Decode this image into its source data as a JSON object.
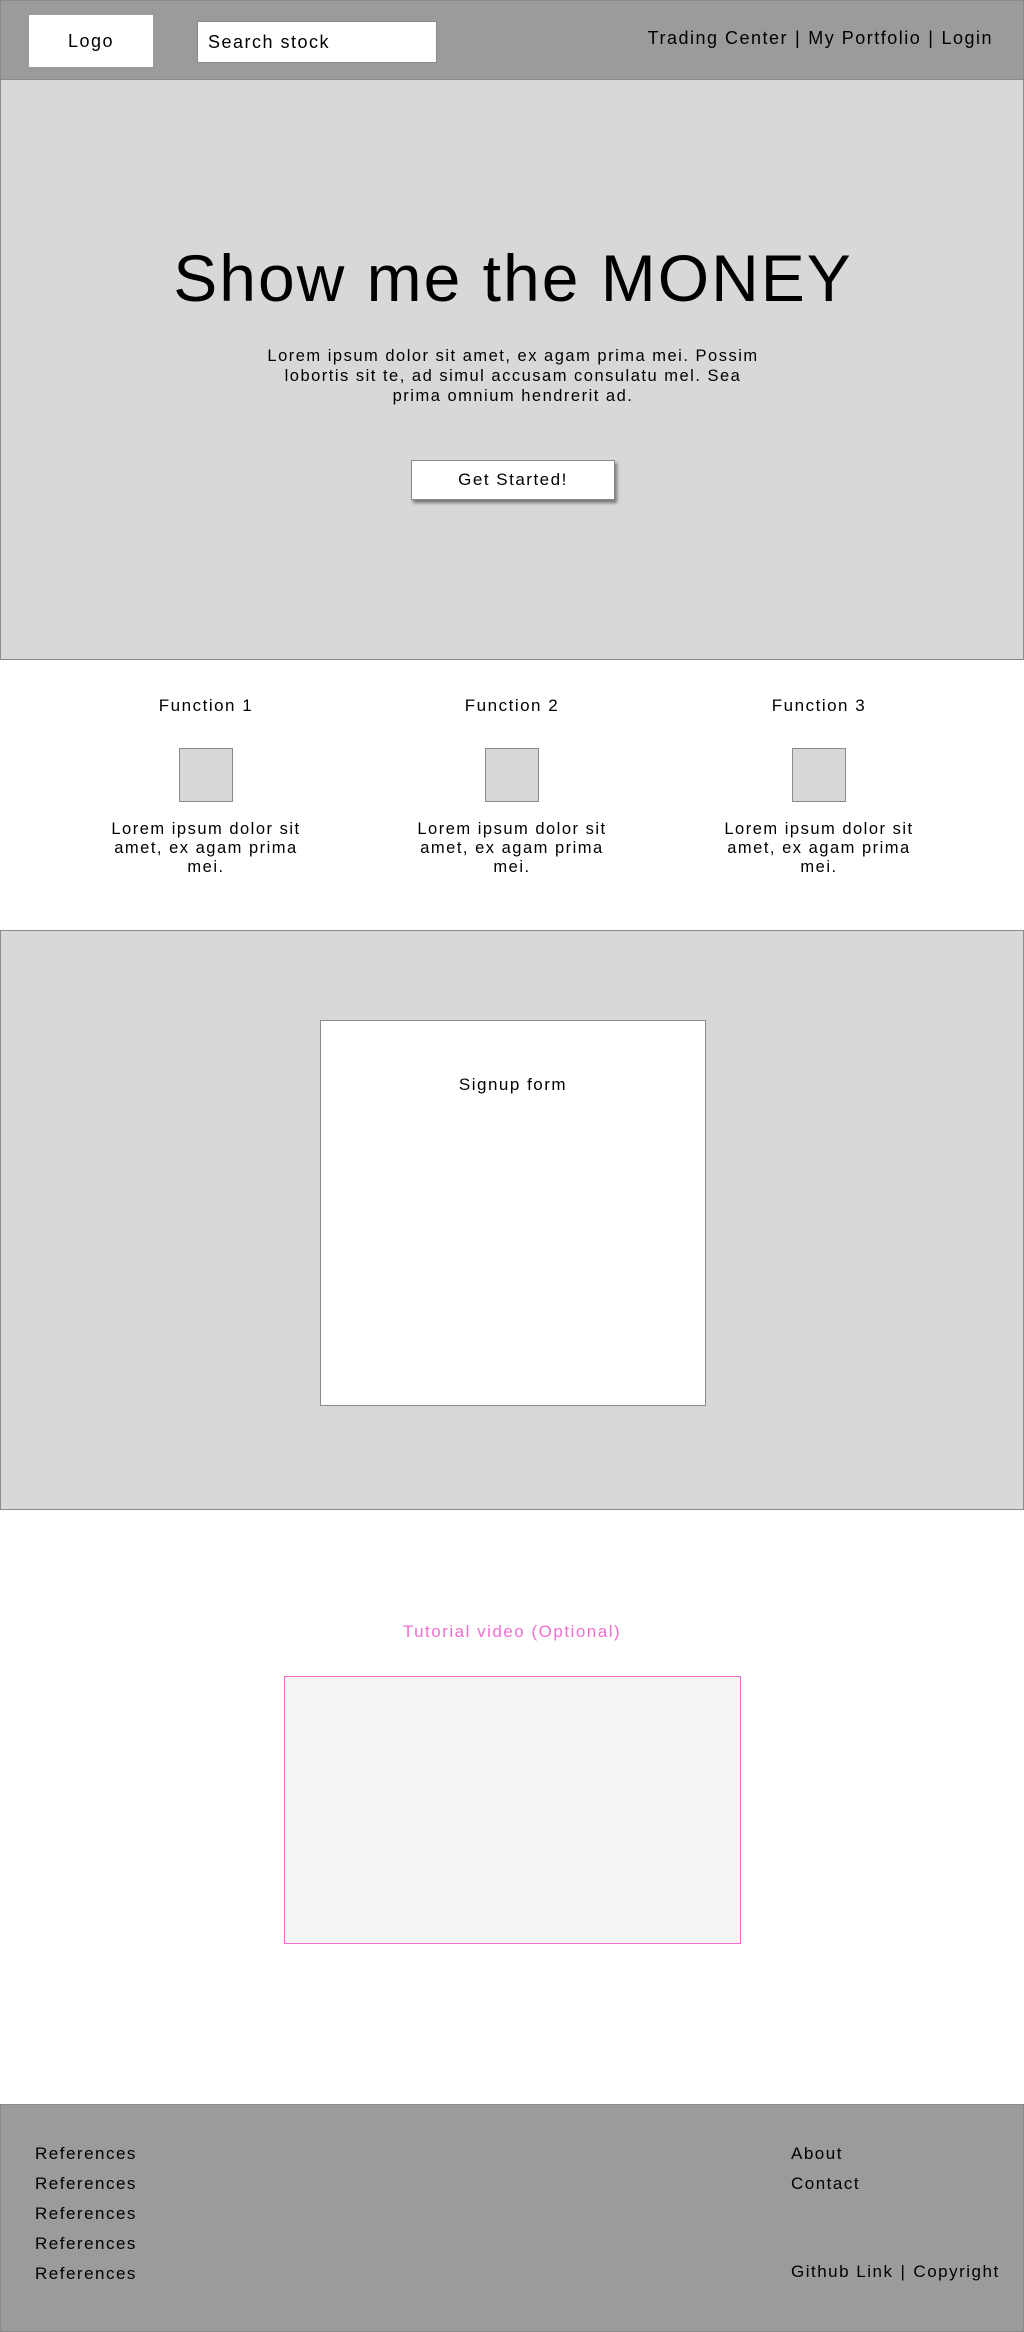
{
  "header": {
    "logo": "Logo",
    "search_placeholder": "Search stock",
    "nav": [
      "Trading Center",
      "My Portfolio",
      "Login"
    ],
    "separator": "|"
  },
  "hero": {
    "title": "Show me the MONEY",
    "text": "Lorem ipsum dolor sit amet, ex agam prima mei. Possim lobortis sit te, ad simul accusam consulatu mel. Sea prima omnium hendrerit ad.",
    "cta": "Get Started!"
  },
  "functions": [
    {
      "title": "Function 1",
      "text": "Lorem ipsum dolor sit amet, ex agam prima mei."
    },
    {
      "title": "Function 2",
      "text": "Lorem ipsum dolor sit amet, ex agam prima mei."
    },
    {
      "title": "Function 3",
      "text": "Lorem ipsum dolor sit amet, ex agam prima mei."
    }
  ],
  "signup": {
    "title": "Signup form"
  },
  "tutorial": {
    "title": "Tutorial video (Optional)",
    "accent": "#f06fcf"
  },
  "footer": {
    "references": [
      "References",
      "References",
      "References",
      "References",
      "References"
    ],
    "links": [
      "About",
      "Contact"
    ],
    "bottom": [
      "Github Link",
      "Copyright"
    ],
    "separator": "|"
  },
  "colors": {
    "header_bg": "#9b9b9b",
    "section_bg": "#d8d8d8",
    "border": "#8a8a8a"
  }
}
